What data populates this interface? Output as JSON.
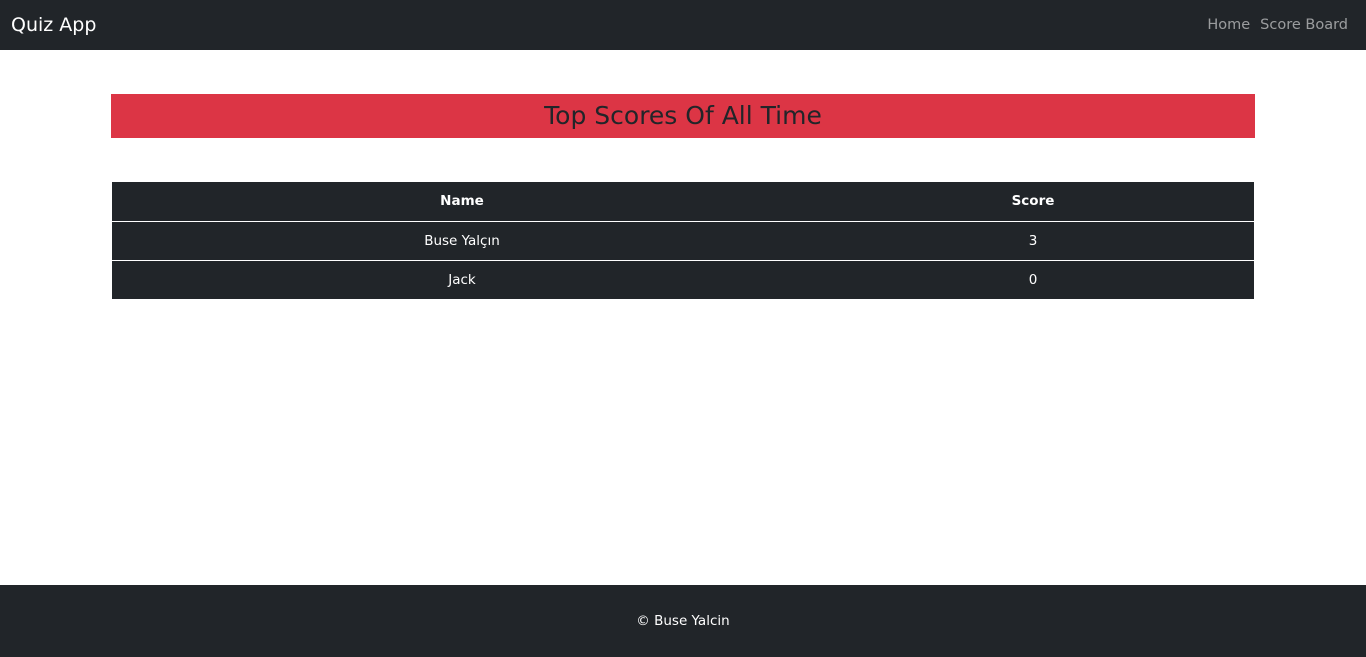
{
  "navbar": {
    "brand": "Quiz App",
    "links": [
      "Home",
      "Score Board"
    ]
  },
  "main": {
    "title": "Top Scores Of All Time",
    "table": {
      "headers": [
        "Name",
        "Score"
      ],
      "rows": [
        [
          "Buse Yalçın",
          "3"
        ],
        [
          "Jack",
          "0"
        ]
      ]
    }
  },
  "footer": {
    "text": "© Buse Yalcin"
  },
  "colors": {
    "dark": "#212529",
    "accent": "#dc3545",
    "white": "#ffffff",
    "nav_link": "#8f9194"
  }
}
